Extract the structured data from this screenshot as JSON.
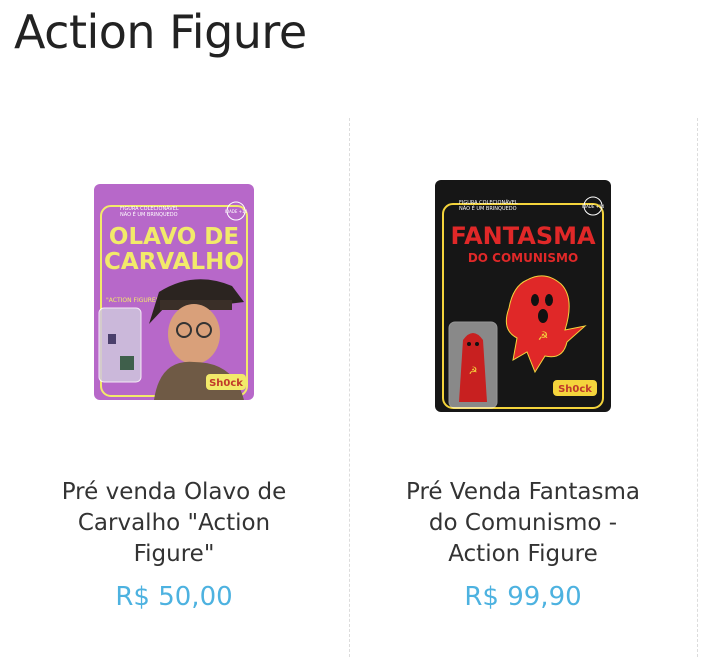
{
  "page": {
    "title": "Action Figure"
  },
  "accent_price_color": "#4db2e0",
  "products": [
    {
      "name": "Pré venda Olavo de Carvalho \"Action Figure\"",
      "price": "R$ 50,00",
      "package": {
        "top_label": "FIGURA COLECIONÁVEL",
        "top_label_2": "NÃO É UM BRINQUEDO",
        "age_badge": "IDADE +14",
        "title_line_1": "OLAVO DE",
        "title_line_2": "CARVALHO",
        "subtitle": "\"ACTION FIGURE\"",
        "brand": "Sh0ck",
        "bg_color": "#b768c9",
        "accent_color": "#f2ea6a"
      }
    },
    {
      "name": "Pré Venda Fantasma do Comunismo - Action Figure",
      "price": "R$ 99,90",
      "package": {
        "top_label": "FIGURA COLECIONÁVEL",
        "top_label_2": "NÃO É UM BRINQUEDO",
        "age_badge": "IDADE +14",
        "title_line_1": "FANTASMA",
        "title_line_2": "DO COMUNISMO",
        "brand": "Sh0ck",
        "bg_color": "#161616",
        "accent_color": "#f4d43c",
        "ghost_color": "#e02828"
      }
    }
  ]
}
